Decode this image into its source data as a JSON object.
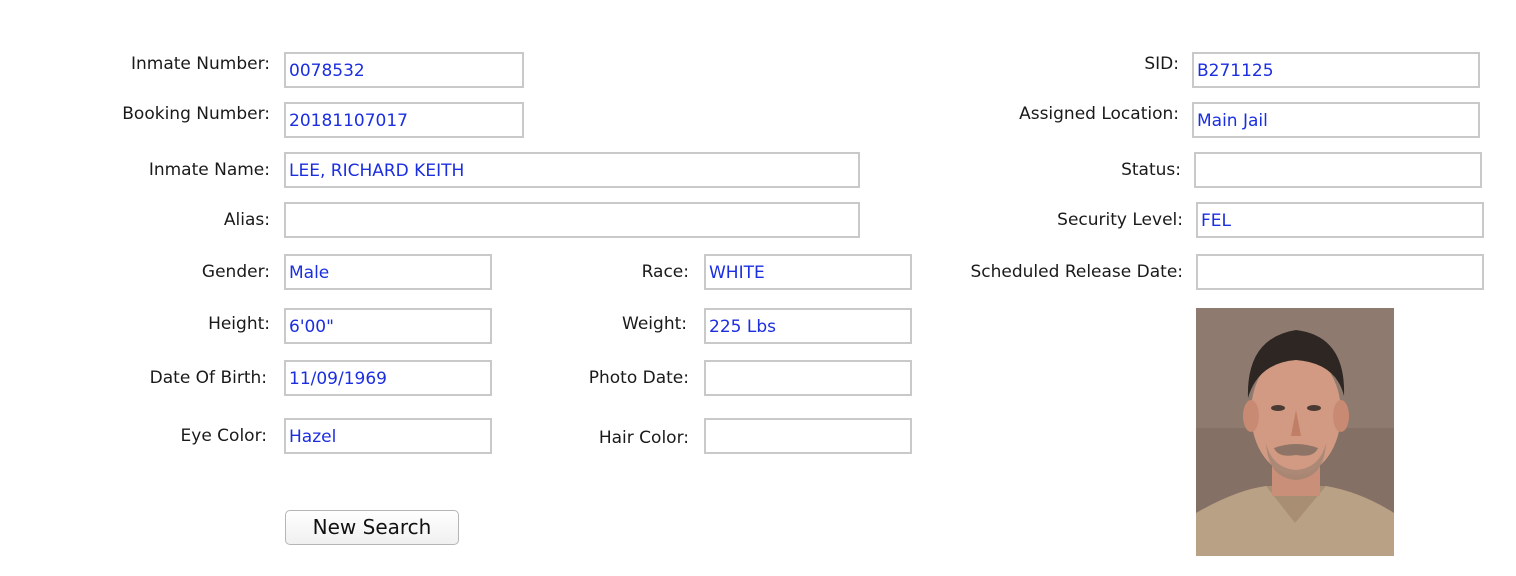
{
  "form": {
    "inmate_number": {
      "label": "Inmate Number:",
      "value": "0078532"
    },
    "booking_number": {
      "label": "Booking Number:",
      "value": "20181107017"
    },
    "inmate_name": {
      "label": "Inmate Name:",
      "value": "LEE, RICHARD KEITH"
    },
    "alias": {
      "label": "Alias:",
      "value": ""
    },
    "gender": {
      "label": "Gender:",
      "value": "Male"
    },
    "race": {
      "label": "Race:",
      "value": "WHITE"
    },
    "height": {
      "label": "Height:",
      "value": "6'00\""
    },
    "weight": {
      "label": "Weight:",
      "value": "225 Lbs"
    },
    "dob": {
      "label": "Date Of Birth:",
      "value": "11/09/1969"
    },
    "photo_date": {
      "label": "Photo Date:",
      "value": ""
    },
    "eye_color": {
      "label": "Eye Color:",
      "value": "Hazel"
    },
    "hair_color": {
      "label": "Hair Color:",
      "value": ""
    },
    "sid": {
      "label": "SID:",
      "value": "B271125"
    },
    "assigned_location": {
      "label": "Assigned Location:",
      "value": "Main Jail"
    },
    "status": {
      "label": "Status:",
      "value": ""
    },
    "security_level": {
      "label": "Security Level:",
      "value": "FEL"
    },
    "scheduled_release_date": {
      "label": "Scheduled Release Date:",
      "value": ""
    }
  },
  "buttons": {
    "new_search": "New Search"
  },
  "colors": {
    "value_text": "#1b2ee0",
    "field_border": "#c9c9c9"
  }
}
